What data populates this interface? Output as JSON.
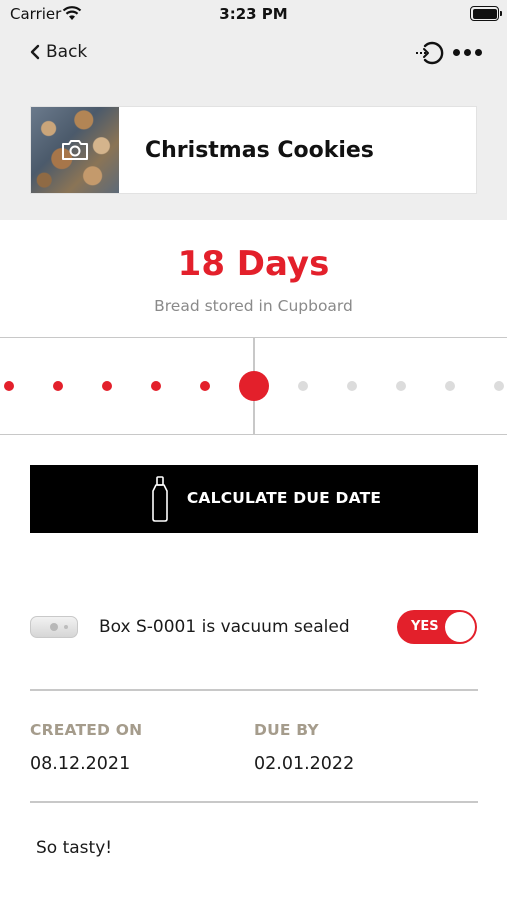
{
  "status_bar": {
    "carrier": "Carrier",
    "time": "3:23 PM"
  },
  "nav": {
    "back_label": "Back",
    "exit_icon": "exit-icon",
    "more_icon": "more-icon"
  },
  "item": {
    "title": "Christmas Cookies",
    "photo_icon": "camera-icon"
  },
  "storage": {
    "days_label": "18 Days",
    "description": "Bread stored in Cupboard"
  },
  "timeline": {
    "current_index": 5,
    "total_dots": 11,
    "active_color": "#e3202b",
    "inactive_color": "#dcdcdc"
  },
  "calc_button": {
    "label": "CALCULATE DUE DATE",
    "icon": "bottle-icon"
  },
  "seal": {
    "label": "Box S-0001 is vacuum sealed",
    "toggle_label": "YES",
    "toggle_on": true
  },
  "dates": {
    "created_head": "CREATED ON",
    "created_value": "08.12.2021",
    "due_head": "DUE BY",
    "due_value": "02.01.2022"
  },
  "notes": "So tasty!",
  "colors": {
    "accent": "#e3202b",
    "header_bg": "#eeeeee",
    "label_tan": "#a59c8c"
  }
}
